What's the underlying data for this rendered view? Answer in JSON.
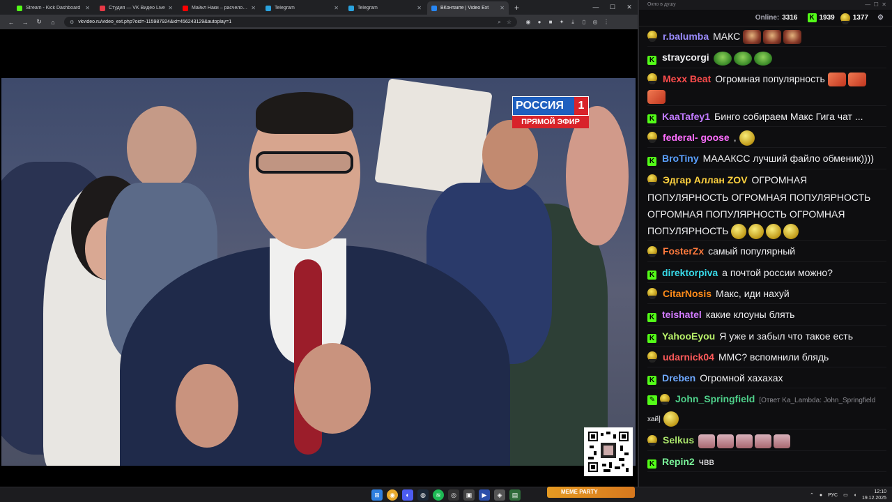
{
  "browser": {
    "tabs": [
      {
        "label": "Stream - Kick Dashboard",
        "color": "#53fc18",
        "active": false
      },
      {
        "label": "Студия — VK Видео Live",
        "color": "#e63946",
        "active": false
      },
      {
        "label": "Майкл Наки – расчеловечив...",
        "color": "#ff0000",
        "active": false
      },
      {
        "label": "Telegram",
        "color": "#2aa3df",
        "active": false
      },
      {
        "label": "Telegram",
        "color": "#2aa3df",
        "active": false
      },
      {
        "label": "ВКонтакте | Video Ext",
        "color": "#2787f5",
        "active": true
      }
    ],
    "new_tab": "+",
    "url": "vkvideo.ru/video_ext.php?oid=-115987924&id=456243129&autoplay=1",
    "window_controls": {
      "minimize": "—",
      "maximize": "☐",
      "close": "✕"
    }
  },
  "video": {
    "channel": "РОССИЯ",
    "channel_number": "1",
    "live_label": "ПРЯМОЙ ЭФИР"
  },
  "chat": {
    "window_title": "Окно в душу",
    "online_label": "Online:",
    "online_count": "3316",
    "kick_count": "1939",
    "gold_count": "1377",
    "messages": [
      {
        "user": "r.balumba",
        "color": "#9b8cff",
        "badge": "gold",
        "text": "МАКС",
        "emotes": [
          "red",
          "red",
          "red"
        ]
      },
      {
        "user": "straycorgi",
        "color": "#efeff1",
        "badge": "kick",
        "text": "",
        "emotes": [
          "frog",
          "frog",
          "frog"
        ]
      },
      {
        "user": "Mexx Beat",
        "color": "#ff4d4d",
        "badge": "gold",
        "text": "Огромная популярность",
        "emotes": [
          "face",
          "face",
          "face"
        ]
      },
      {
        "user": "KaaTafey1",
        "color": "#c27bff",
        "badge": "kick",
        "text": "Бинго собираем Макс Гига чат ...",
        "emotes": []
      },
      {
        "user": "federal- goose",
        "color": "#ff6eff",
        "badge": "gold",
        "text": ",",
        "emotes": [
          "gold"
        ]
      },
      {
        "user": "BroTiny",
        "color": "#5aa0ff",
        "badge": "kick",
        "text": "МАААКСС лучший файло обменик))))",
        "emotes": []
      },
      {
        "user": "Эдгар Аллан ZOV",
        "color": "#ffd23f",
        "badge": "gold",
        "text": "ОГРОМНАЯ ПОПУЛЯРНОСТЬ ОГРОМНАЯ ПОПУЛЯРНОСТЬ ОГРОМНАЯ ПОПУЛЯРНОСТЬ ОГРОМНАЯ ПОПУЛЯРНОСТЬ",
        "emotes": [
          "gold",
          "gold",
          "gold",
          "gold"
        ]
      },
      {
        "user": "FosterZx",
        "color": "#ff7a3d",
        "badge": "gold",
        "text": "самый популярный",
        "emotes": []
      },
      {
        "user": "direktorpiva",
        "color": "#38d9e8",
        "badge": "kick",
        "text": "а почтой россии можно?",
        "emotes": []
      },
      {
        "user": "CitarNosis",
        "color": "#ff8c1a",
        "badge": "gold",
        "text": "Макс, иди нахуй",
        "emotes": []
      },
      {
        "user": "teishatel",
        "color": "#d27bff",
        "badge": "kick",
        "text": "какие клоуны блять",
        "emotes": []
      },
      {
        "user": "YahooEyou",
        "color": "#b9f26a",
        "badge": "kick",
        "text": "Я уже и забыл что такое есть",
        "emotes": []
      },
      {
        "user": "udarnick04",
        "color": "#ff5a5a",
        "badge": "gold",
        "text": "ММС? вспомнили блядь",
        "emotes": []
      },
      {
        "user": "Dreben",
        "color": "#6ea8ff",
        "badge": "kick",
        "text": "Огромной хахахах",
        "emotes": []
      },
      {
        "user": "John_Springfield",
        "color": "#4fd18b",
        "badge": "edit",
        "reply": "[Ответ Ka_Lambda: John_Springfield",
        "text": "хай]",
        "emotes": [
          "gold"
        ]
      },
      {
        "user": "Selkus",
        "color": "#a8e26a",
        "badge": "gold",
        "text": "",
        "emotes": [
          "pink",
          "pink",
          "pink",
          "pink",
          "pink"
        ]
      },
      {
        "user": "Repin2",
        "color": "#7af59a",
        "badge": "kick",
        "text": "чвв",
        "emotes": []
      }
    ]
  },
  "taskbar": {
    "meme_label": "MEME PARTY",
    "lang": "РУС",
    "time": "12:10",
    "date": "19.12.2025"
  }
}
